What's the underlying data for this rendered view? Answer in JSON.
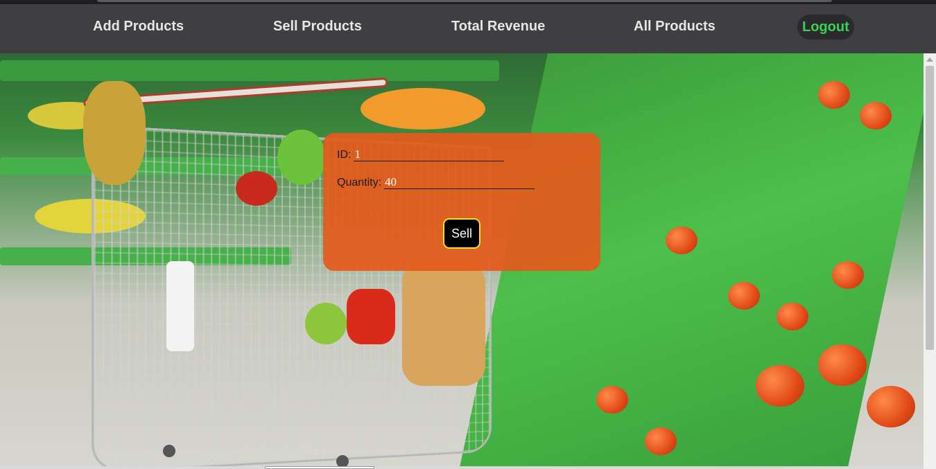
{
  "nav": {
    "add_products": "Add Products",
    "sell_products": "Sell Products",
    "total_revenue": "Total Revenue",
    "all_products": "All Products",
    "logout": "Logout"
  },
  "form": {
    "id_label": "ID:",
    "id_value": "1",
    "quantity_label": "Quantity:",
    "quantity_value": "40",
    "submit_label": "Sell"
  },
  "colors": {
    "navbar": "#3f3f42",
    "panel": "#e45a1c",
    "logout_text": "#39d353",
    "button_border": "#f4e21a"
  },
  "background": {
    "image_subject": "supermarket-cart-and-produce-photo"
  }
}
